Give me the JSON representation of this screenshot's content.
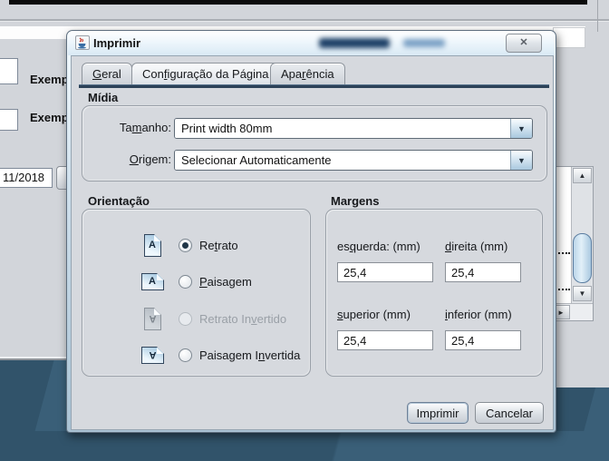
{
  "colors": {
    "accent_navy": "#2c4258",
    "panel_gray": "#d6d9de",
    "teal_background": "#33566d",
    "scroll_thumb_blue": "#cfe3f2"
  },
  "window": {
    "title": "Imprimir",
    "close_glyph": "✕"
  },
  "tabs": [
    {
      "pre": "",
      "m": "G",
      "post": "eral"
    },
    {
      "pre": "Con",
      "m": "f",
      "post": "iguração da Página"
    },
    {
      "pre": "Apa",
      "m": "r",
      "post": "ência"
    }
  ],
  "media": {
    "title": "Mídia",
    "size_label": {
      "pre": "Ta",
      "m": "m",
      "post": "anho:"
    },
    "size_value": "Print width 80mm",
    "source_label": {
      "pre": "",
      "m": "O",
      "post": "rigem:"
    },
    "source_value": "Selecionar Automaticamente",
    "dropdown_glyph": "▼"
  },
  "orientation": {
    "title": "Orientação",
    "options": [
      {
        "pre": "Re",
        "m": "t",
        "post": "rato",
        "icon_letter": "A"
      },
      {
        "pre": "",
        "m": "P",
        "post": "aisagem",
        "icon_letter": "A"
      },
      {
        "pre": "Retrato In",
        "m": "v",
        "post": "ertido",
        "icon_letter": "A"
      },
      {
        "pre": "Paisagem I",
        "m": "n",
        "post": "vertida",
        "icon_letter": "A"
      }
    ]
  },
  "margins": {
    "title": "Margens",
    "fields": [
      {
        "pre": "es",
        "m": "q",
        "post": "uerda: (mm)",
        "value": "25,4"
      },
      {
        "pre": "",
        "m": "d",
        "post": "ireita (mm)",
        "value": "25,4"
      },
      {
        "pre": "",
        "m": "s",
        "post": "uperior (mm)",
        "value": "25,4"
      },
      {
        "pre": "",
        "m": "i",
        "post": "nferior (mm)",
        "value": "25,4"
      }
    ]
  },
  "actions": {
    "print": "Imprimir",
    "cancel": "Cancelar"
  },
  "background": {
    "label_1": "Exemp",
    "label_2": "Exemp",
    "date_value": "11/2018",
    "scroll_up_glyph": "▲",
    "scroll_down_glyph": "▼",
    "scroll_right_glyph": "►"
  }
}
